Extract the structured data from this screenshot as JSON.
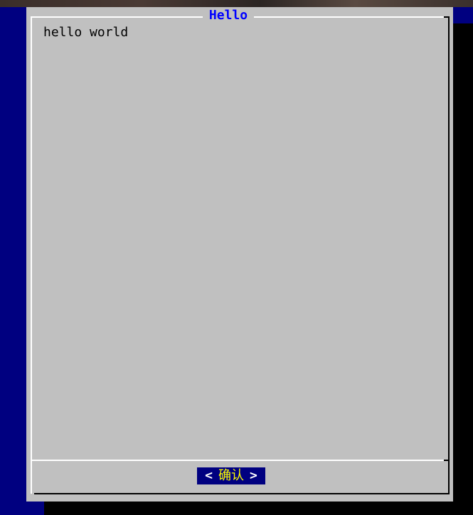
{
  "dialog": {
    "title": "Hello",
    "text": "hello world",
    "ok_button": {
      "left_bracket": "<",
      "label": "确认",
      "right_bracket": ">"
    }
  },
  "colors": {
    "terminal_background": "#000080",
    "dialog_background": "#c0c0c0",
    "title_text": "#0000ff",
    "button_background": "#000080",
    "button_label": "#ffff00",
    "button_brackets": "#ffffff"
  }
}
